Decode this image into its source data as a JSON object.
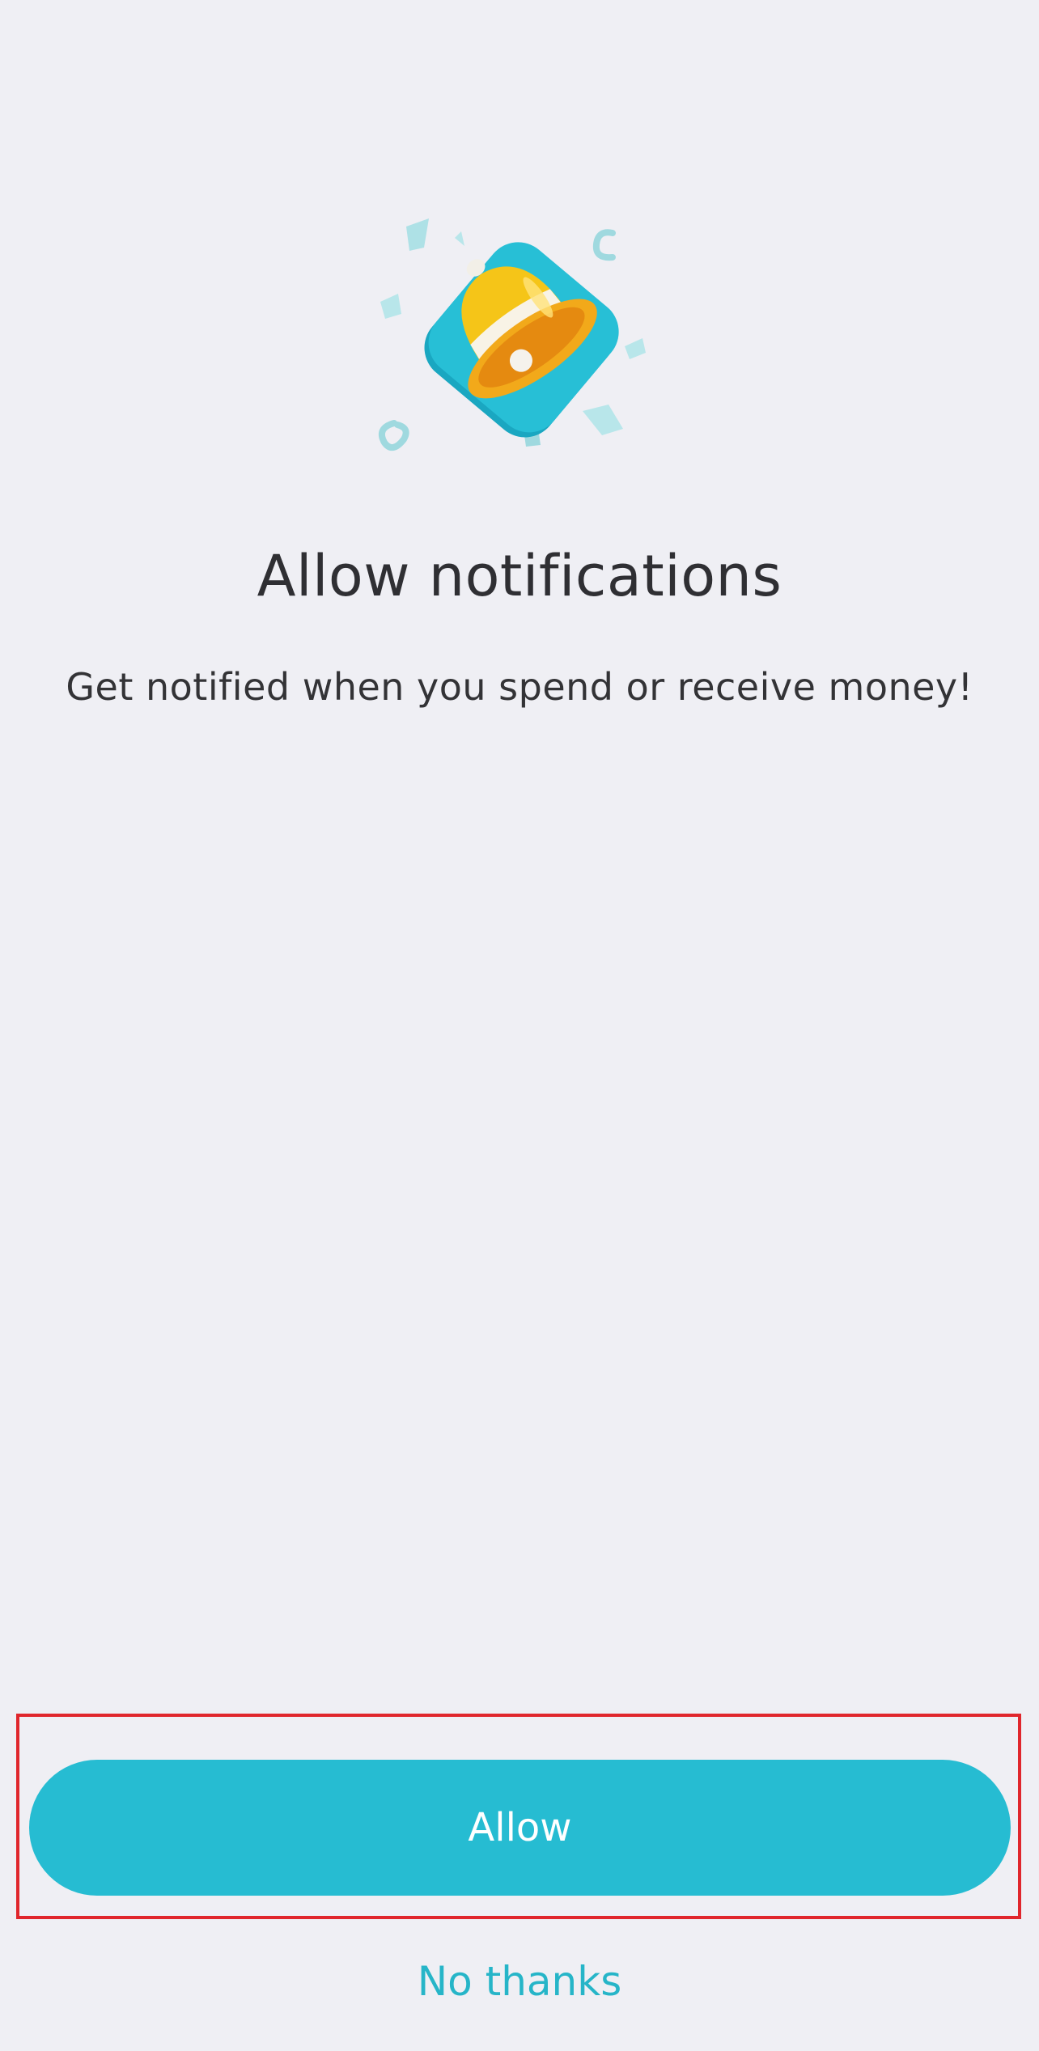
{
  "screen": {
    "title": "Allow notifications",
    "subtitle": "Get notified when you spend or receive money!"
  },
  "illustration": {
    "icon": "bell-icon"
  },
  "actions": {
    "allow_label": "Allow",
    "decline_label": "No thanks"
  },
  "colors": {
    "background": "#efeff4",
    "accent": "#26bcd2",
    "highlight_border": "#e0262c",
    "bell_yellow": "#f5c518",
    "tile_blue": "#1fb6cf"
  }
}
